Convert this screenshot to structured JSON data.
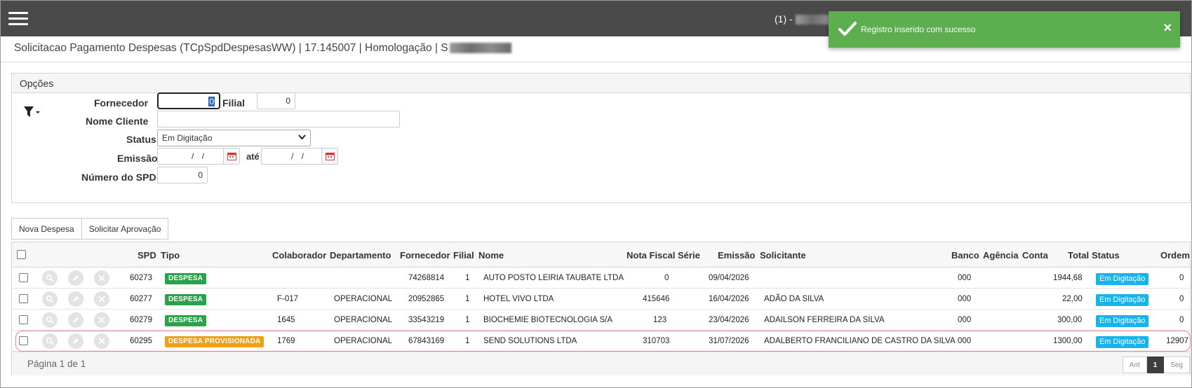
{
  "toast": {
    "message": "Registro inserido com sucesso",
    "close": "×"
  },
  "header": {
    "user_prefix": "(1) -"
  },
  "page": {
    "title": "Solicitacao Pagamento Despesas (TCpSpdDespesasWW) | 17.145007 | Homologação | S"
  },
  "options": {
    "panel_title": "Opções",
    "fornecedor_label": "Fornecedor",
    "fornecedor_value": "0",
    "filial_label": "Filial",
    "filial_value": "0",
    "nome_cliente_label": "Nome Cliente",
    "nome_cliente_value": "",
    "status_label": "Status",
    "status_value": "Em Digitação",
    "emissao_label": "Emissão",
    "emissao_from": "/ /",
    "ate_label": "até",
    "emissao_to": "/ /",
    "numero_spd_label": "Número do SPD",
    "numero_spd_value": "0"
  },
  "toolbar": {
    "nova_despesa": "Nova Despesa",
    "solicitar_aprovacao": "Solicitar Aprovação"
  },
  "table": {
    "columns": {
      "spd": "SPD",
      "tipo": "Tipo",
      "colaborador": "Colaborador",
      "departamento": "Departamento",
      "fornecedor": "Fornecedor",
      "filial": "Filial",
      "nome": "Nome",
      "nota_fiscal": "Nota Fiscal",
      "serie": "Série",
      "emissao": "Emissão",
      "solicitante": "Solicitante",
      "banco": "Banco",
      "agencia": "Agência",
      "conta": "Conta",
      "total": "Total",
      "status": "Status",
      "ordem": "Ordem"
    },
    "rows": [
      {
        "spd": "60273",
        "tipo": "DESPESA",
        "colaborador": "",
        "departamento": "",
        "fornecedor": "74268814",
        "filial": "1",
        "nome": "AUTO POSTO LEIRIA TAUBATE LTDA",
        "nota_fiscal": "0",
        "emissao": "09/04/2026",
        "solicitante": "",
        "banco": "000",
        "total": "1944,68",
        "status": "Em Digitação",
        "ordem": "0"
      },
      {
        "spd": "60277",
        "tipo": "DESPESA",
        "colaborador": "F-017",
        "departamento": "OPERACIONAL",
        "fornecedor": "20952865",
        "filial": "1",
        "nome": "HOTEL VIVO LTDA",
        "nota_fiscal": "415646",
        "emissao": "16/04/2026",
        "solicitante": "ADÃO DA SILVA",
        "banco": "000",
        "total": "22,00",
        "status": "Em Digitação",
        "ordem": "0"
      },
      {
        "spd": "60279",
        "tipo": "DESPESA",
        "colaborador": "1645",
        "departamento": "OPERACIONAL",
        "fornecedor": "33543219",
        "filial": "1",
        "nome": "BIOCHEMIE BIOTECNOLOGIA S/A",
        "nota_fiscal": "123",
        "emissao": "23/04/2026",
        "solicitante": "ADAILSON FERREIRA DA SILVA",
        "banco": "000",
        "total": "300,00",
        "status": "Em Digitação",
        "ordem": "0"
      },
      {
        "spd": "60295",
        "tipo": "DESPESA PROVISIONADA",
        "colaborador": "1769",
        "departamento": "OPERACIONAL",
        "fornecedor": "67843169",
        "filial": "1",
        "nome": "SEND SOLUTIONS LTDA",
        "nota_fiscal": "310703",
        "emissao": "31/07/2026",
        "solicitante": "ADALBERTO FRANCILIANO DE CASTRO DA SILVA",
        "banco": "000",
        "total": "1300,00",
        "status": "Em Digitação",
        "ordem": "12907"
      }
    ]
  },
  "pagination": {
    "info": "Página 1 de 1",
    "prev": "Ant",
    "current": "1",
    "next": "Seg"
  },
  "colors": {
    "topbar": "#4a4a4a",
    "toast": "#5cae4f",
    "despesa": "#2aa24a",
    "provisionada": "#f0a018",
    "status": "#15b4ec",
    "highlight": "#e9848f"
  }
}
